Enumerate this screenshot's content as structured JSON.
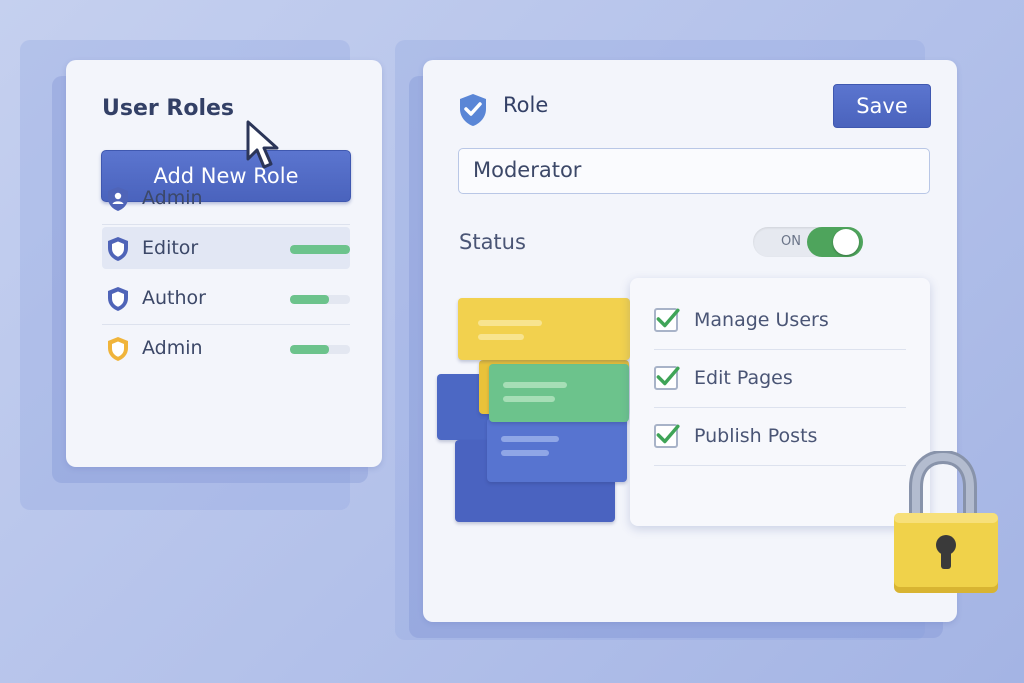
{
  "left": {
    "title": "User Roles",
    "add_button": "Add New Role",
    "roles": [
      {
        "label": "Admin",
        "icon": "shield-user-icon",
        "color": "#4f64b8",
        "bar": null
      },
      {
        "label": "Editor",
        "icon": "shield-icon",
        "color": "#4f64b8",
        "bar": 1.0,
        "selected": true
      },
      {
        "label": "Author",
        "icon": "shield-icon",
        "color": "#4f64b8",
        "bar": 0.65
      },
      {
        "label": "Admin",
        "icon": "shield-icon",
        "color": "#f0b43a",
        "bar": 0.65
      }
    ]
  },
  "right": {
    "heading": "Role",
    "save_label": "Save",
    "role_name_value": "Moderator",
    "status_label": "Status",
    "toggle_text": "ON",
    "toggle_on": true,
    "permissions": [
      {
        "label": "Manage Users",
        "checked": true
      },
      {
        "label": "Edit Pages",
        "checked": true
      },
      {
        "label": "Publish Posts",
        "checked": true
      }
    ]
  },
  "colors": {
    "primary": "#4a63bd",
    "success": "#4ea45c",
    "check": "#3fa457",
    "lock": "#f0d24a"
  }
}
